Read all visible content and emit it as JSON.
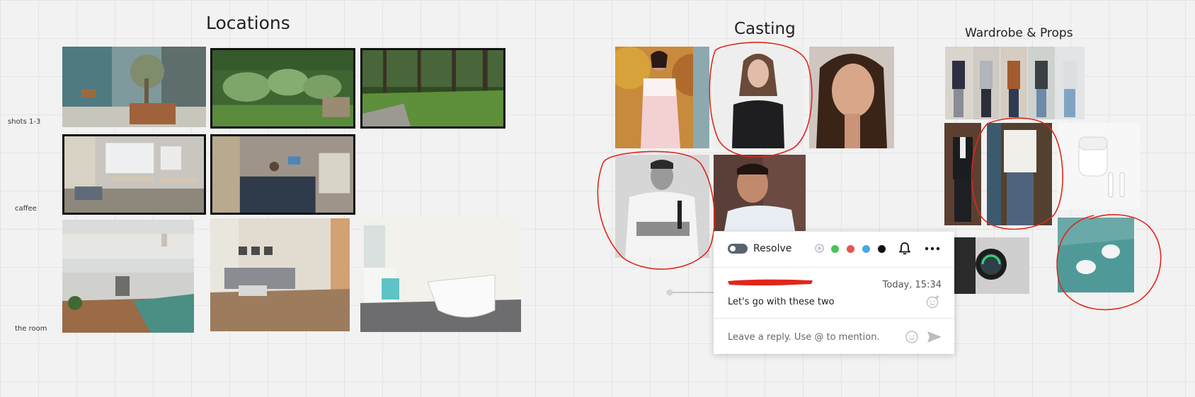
{
  "sections": {
    "locations": "Locations",
    "casting": "Casting",
    "wardrobe": "Wardrobe & Props"
  },
  "rows": {
    "shots": "shots 1-3",
    "caffee": "caffee",
    "room": "the room"
  },
  "comment": {
    "resolve_label": "Resolve",
    "timestamp": "Today, 15:34",
    "text": "Let's go with these two",
    "reply_placeholder": "Leave a reply. Use @ to mention.",
    "colors": [
      "#c9c9d6",
      "#4cc15a",
      "#e55353",
      "#49a8e8",
      "#111111"
    ],
    "annotation_color": "#e0261b"
  }
}
